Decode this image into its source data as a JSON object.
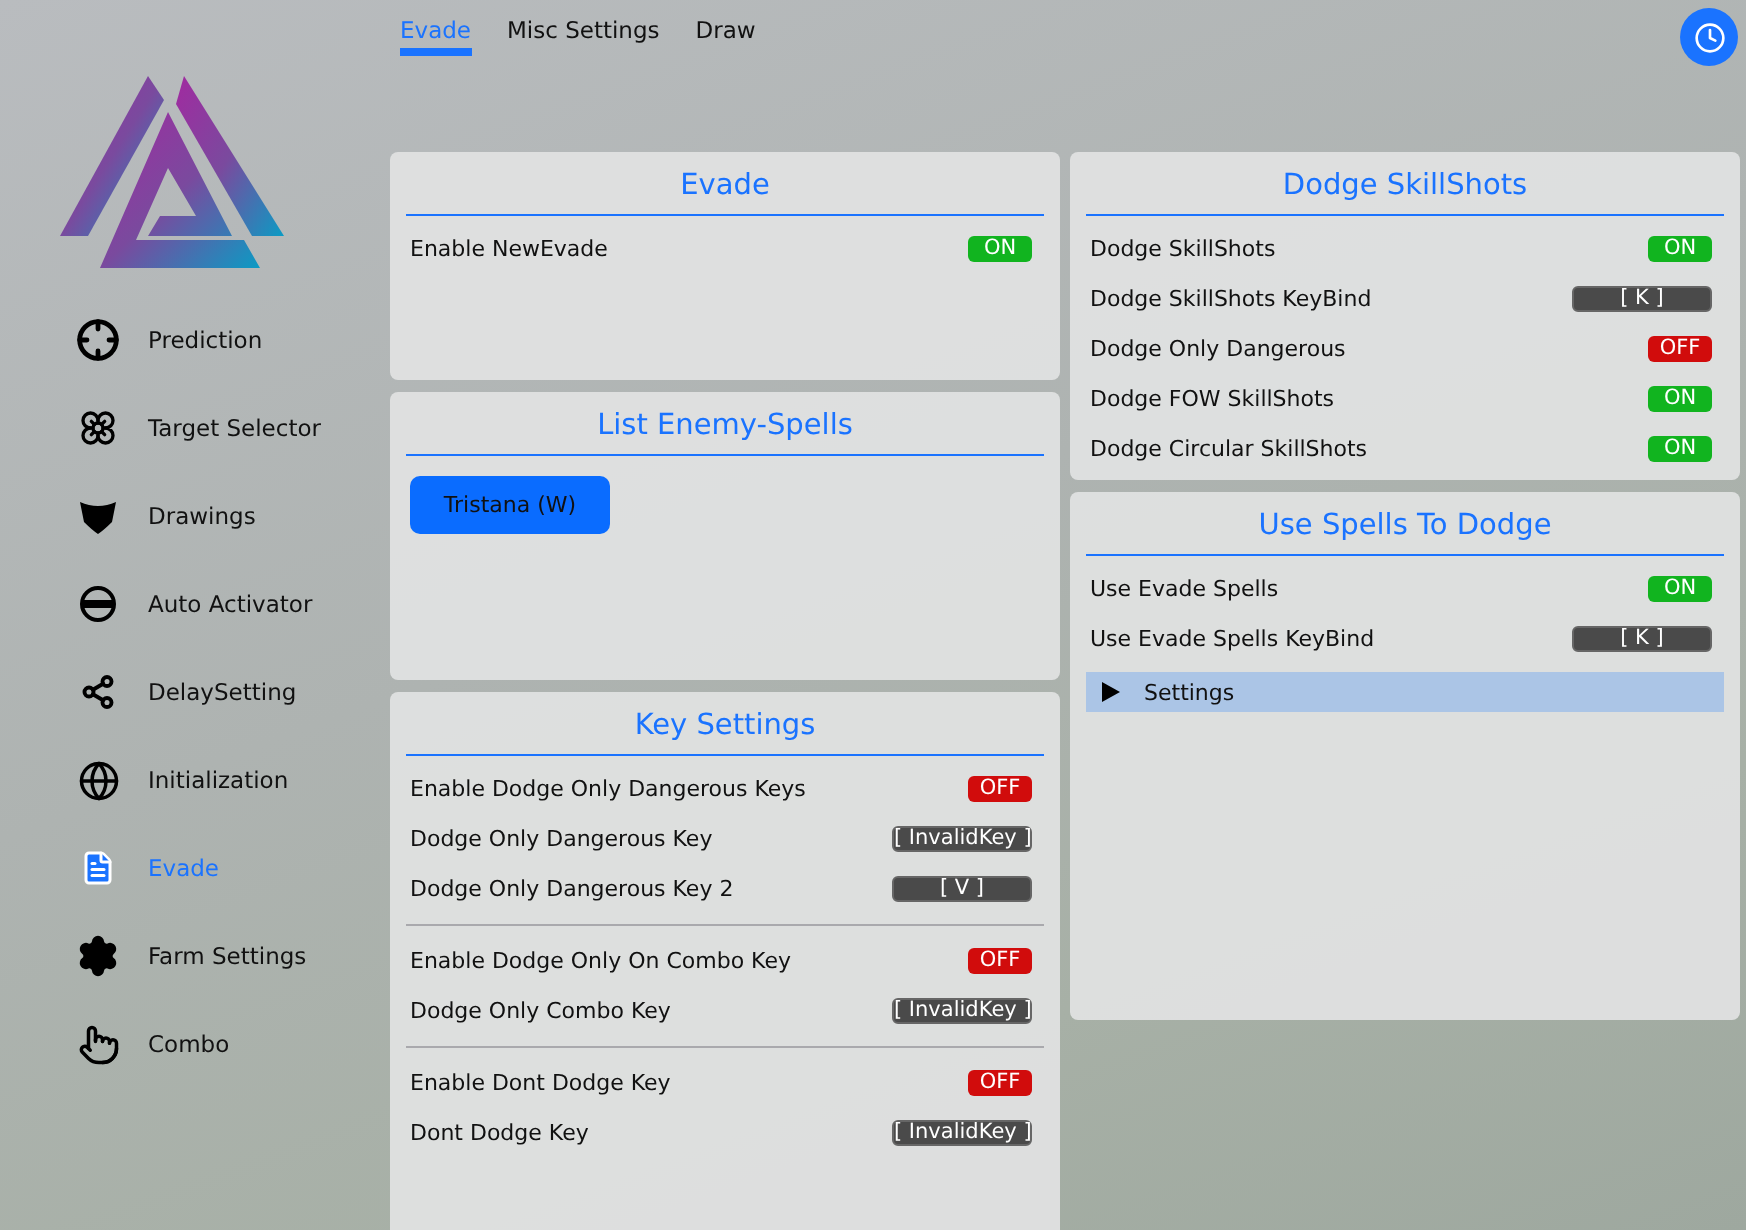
{
  "sidebar": {
    "items": [
      {
        "label": "Prediction",
        "selected": false
      },
      {
        "label": "Target Selector",
        "selected": false
      },
      {
        "label": "Drawings",
        "selected": false
      },
      {
        "label": "Auto Activator",
        "selected": false
      },
      {
        "label": "DelaySetting",
        "selected": false
      },
      {
        "label": "Initialization",
        "selected": false
      },
      {
        "label": "Evade",
        "selected": true
      },
      {
        "label": "Farm Settings",
        "selected": false
      },
      {
        "label": "Combo",
        "selected": false
      }
    ]
  },
  "tabs": [
    {
      "label": "Evade",
      "selected": true
    },
    {
      "label": "Misc Settings",
      "selected": false
    },
    {
      "label": "Draw",
      "selected": false
    }
  ],
  "left_panels": [
    {
      "title": "Evade",
      "groups": [
        [
          {
            "kind": "toggle",
            "label": "Enable NewEvade",
            "on": true,
            "value": "ON"
          }
        ]
      ]
    },
    {
      "title": "List Enemy-Spells",
      "spells": [
        "Tristana (W)"
      ]
    },
    {
      "title": "Key Settings",
      "groups": [
        [
          {
            "kind": "toggle",
            "label": "Enable Dodge Only Dangerous Keys",
            "on": false,
            "value": "OFF"
          },
          {
            "kind": "keybind",
            "label": "Dodge Only Dangerous Key",
            "value": "[ InvalidKey ]"
          },
          {
            "kind": "keybind",
            "label": "Dodge Only Dangerous Key 2",
            "value": "[ V ]"
          }
        ],
        [
          {
            "kind": "toggle",
            "label": "Enable Dodge Only On Combo Key",
            "on": false,
            "value": "OFF"
          },
          {
            "kind": "keybind",
            "label": "Dodge Only Combo Key",
            "value": "[ InvalidKey ]"
          }
        ],
        [
          {
            "kind": "toggle",
            "label": "Enable Dont Dodge Key",
            "on": false,
            "value": "OFF"
          },
          {
            "kind": "keybind",
            "label": "Dont Dodge Key",
            "value": "[ InvalidKey ]"
          }
        ]
      ]
    }
  ],
  "right_panels": [
    {
      "title": "Dodge SkillShots",
      "groups": [
        [
          {
            "kind": "toggle",
            "label": "Dodge SkillShots",
            "on": true,
            "value": "ON"
          },
          {
            "kind": "keybind",
            "label": "Dodge SkillShots KeyBind",
            "value": "[ K ]"
          },
          {
            "kind": "toggle",
            "label": "Dodge Only Dangerous",
            "on": false,
            "value": "OFF"
          },
          {
            "kind": "toggle",
            "label": "Dodge FOW SkillShots",
            "on": true,
            "value": "ON"
          },
          {
            "kind": "toggle",
            "label": "Dodge Circular SkillShots",
            "on": true,
            "value": "ON"
          }
        ]
      ]
    },
    {
      "title": "Use Spells To Dodge",
      "groups": [
        [
          {
            "kind": "toggle",
            "label": "Use Evade Spells",
            "on": true,
            "value": "ON"
          },
          {
            "kind": "keybind",
            "label": "Use Evade Spells KeyBind",
            "value": "[ K ]"
          },
          {
            "kind": "section",
            "label": "Settings",
            "expanded": false
          }
        ]
      ]
    }
  ]
}
